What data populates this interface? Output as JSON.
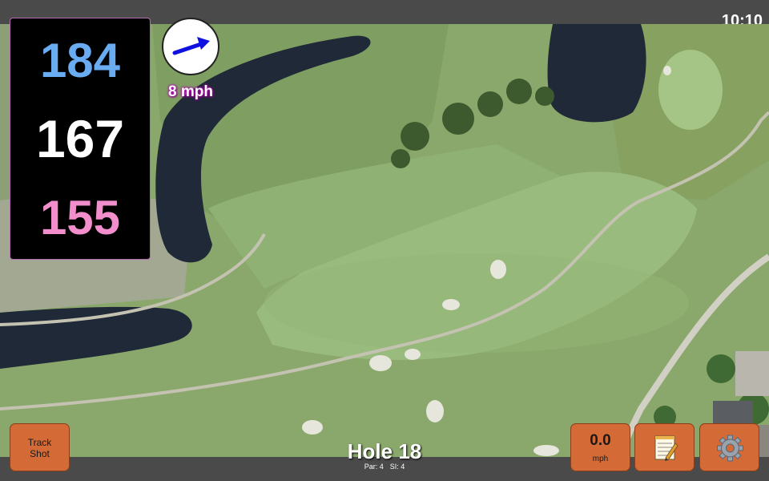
{
  "status_bar": {
    "time": "10:10"
  },
  "yardage": {
    "back": "184",
    "middle": "167",
    "front": "155",
    "colors": {
      "back": "#6aacf2",
      "middle": "#ffffff",
      "front": "#f28ecb"
    }
  },
  "wind": {
    "speed": "8 mph",
    "arrow_icon": "wind-direction-arrow-icon",
    "arrow_color": "#1010e0"
  },
  "hole": {
    "title": "Hole 18",
    "par": "Par: 4",
    "si": "SI: 4"
  },
  "buttons": {
    "track_shot_line1": "Track",
    "track_shot_line2": "Shot",
    "speed_value": "0.0",
    "speed_unit": "mph",
    "notes_icon": "notepad-icon",
    "settings_icon": "gear-icon",
    "color": "#d46a35"
  }
}
